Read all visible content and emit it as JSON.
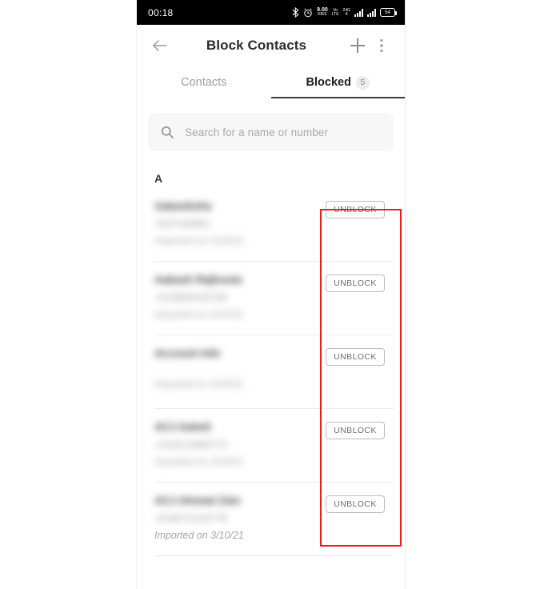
{
  "status_bar": {
    "time": "00:18",
    "icons": [
      {
        "name": "bluetooth-icon",
        "glyph": "✶"
      },
      {
        "name": "alarm-icon",
        "glyph": "⏰"
      }
    ],
    "data_speed": {
      "value": "9.00",
      "unit": "KB/S"
    },
    "network_labels": [
      {
        "name": "volte-icon",
        "top": "Vo",
        "bottom": "LTE"
      },
      {
        "name": "volte-4g-icon",
        "top": "24G",
        "bottom": "K"
      }
    ],
    "battery_level": "54"
  },
  "app_bar": {
    "back_label": "←",
    "title": "Block Contacts",
    "add_label": "+",
    "overflow_label": "⋮"
  },
  "tabs": [
    {
      "label": "Contacts",
      "active": false,
      "badge": ""
    },
    {
      "label": "Blocked",
      "active": true,
      "badge": "5"
    }
  ],
  "search": {
    "placeholder": "Search for a name or number",
    "value": "",
    "icon": "search-icon"
  },
  "list": {
    "section_header": "A",
    "unblock_label": "UNBLOCK",
    "contacts": [
      {
        "name": "Aakanksha",
        "number": "7837240882",
        "imported": "Imported on 3/10/21",
        "blurred": true,
        "has_number": true
      },
      {
        "name": "Aakash Rajhouta",
        "number": "+919896423736",
        "imported": "Imported on 3/10/21",
        "blurred": true,
        "has_number": true
      },
      {
        "name": "Account Info",
        "number": "",
        "imported": "Imported on 3/10/21",
        "blurred": true,
        "has_number": false
      },
      {
        "name": "ACJ Aaheli",
        "number": "+918213983770",
        "imported": "Imported on 3/10/21",
        "blurred": true,
        "has_number": true
      },
      {
        "name": "ACJ Ahmad Zain",
        "number": "+918071224778",
        "imported": "Imported on 3/10/21",
        "blurred": false,
        "has_number": true
      }
    ]
  },
  "annotation": {
    "color": "#ee1c25",
    "shape": "rectangle",
    "target": "unblock-button-column"
  }
}
